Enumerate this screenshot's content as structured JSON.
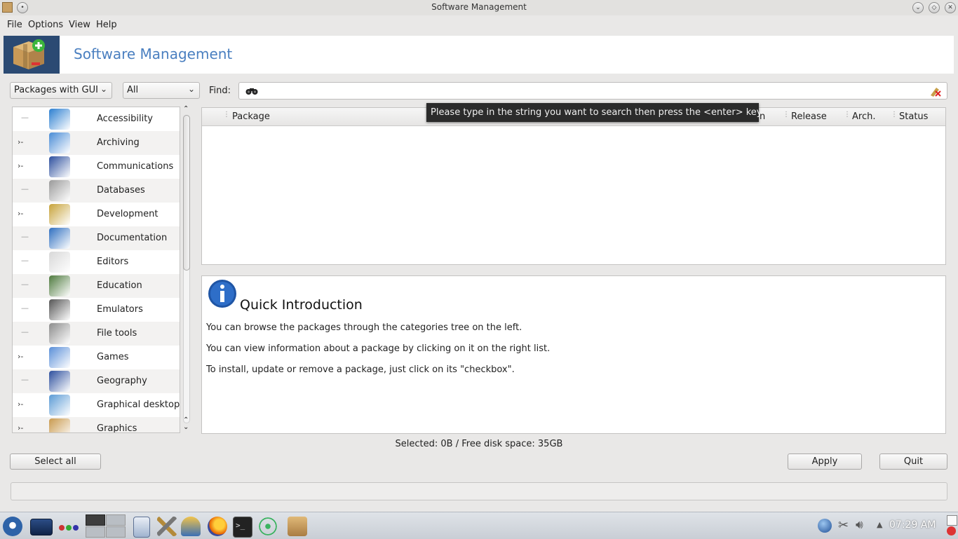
{
  "window": {
    "title": "Software Management"
  },
  "menu": [
    "File",
    "Options",
    "View",
    "Help"
  ],
  "banner": {
    "title": "Software Management"
  },
  "filters": {
    "group_value": "Packages with GUI",
    "state_value": "All",
    "find_label": "Find:",
    "find_value": ""
  },
  "categories": [
    {
      "label": "Accessibility",
      "expandable": false,
      "icon": "accessibility-icon",
      "color": "#2c7fd0"
    },
    {
      "label": "Archiving",
      "expandable": true,
      "icon": "archive-folder-icon",
      "color": "#4a8cd6"
    },
    {
      "label": "Communications",
      "expandable": true,
      "icon": "globe-icon",
      "color": "#2d4f9e"
    },
    {
      "label": "Databases",
      "expandable": false,
      "icon": "database-icon",
      "color": "#9a9a9a"
    },
    {
      "label": "Development",
      "expandable": true,
      "icon": "hammer-icon",
      "color": "#c7a33a"
    },
    {
      "label": "Documentation",
      "expandable": false,
      "icon": "book-icon",
      "color": "#2f6fc0"
    },
    {
      "label": "Editors",
      "expandable": false,
      "icon": "pencil-paper-icon",
      "color": "#d8d8d8"
    },
    {
      "label": "Education",
      "expandable": false,
      "icon": "chalkboard-icon",
      "color": "#4e7a3e"
    },
    {
      "label": "Emulators",
      "expandable": false,
      "icon": "emulator-icon",
      "color": "#555555"
    },
    {
      "label": "File tools",
      "expandable": false,
      "icon": "drive-icon",
      "color": "#8c8c8c"
    },
    {
      "label": "Games",
      "expandable": true,
      "icon": "cards-icon",
      "color": "#5a8fd8"
    },
    {
      "label": "Geography",
      "expandable": false,
      "icon": "globe-icon",
      "color": "#2d4f9e"
    },
    {
      "label": "Graphical desktop",
      "expandable": true,
      "icon": "monitor-icon",
      "color": "#5b9bd5"
    },
    {
      "label": "Graphics",
      "expandable": true,
      "icon": "palette-icon",
      "color": "#c99a4e"
    }
  ],
  "table": {
    "columns": [
      "Package",
      "n",
      "Release",
      "Arch.",
      "Status"
    ]
  },
  "tooltip": "Please type in the string you want to search then press the <enter> key",
  "intro": {
    "title": "Quick Introduction",
    "lines": [
      "You can browse the packages through the categories tree on the left.",
      "You can view information about a package by clicking on it on the right list.",
      "To install, update or remove a package, just click on its \"checkbox\"."
    ]
  },
  "status": "Selected: 0B / Free disk space: 35GB",
  "buttons": {
    "select_all": "Select all",
    "apply": "Apply",
    "quit": "Quit"
  },
  "taskbar": {
    "time": "07:29 AM"
  }
}
